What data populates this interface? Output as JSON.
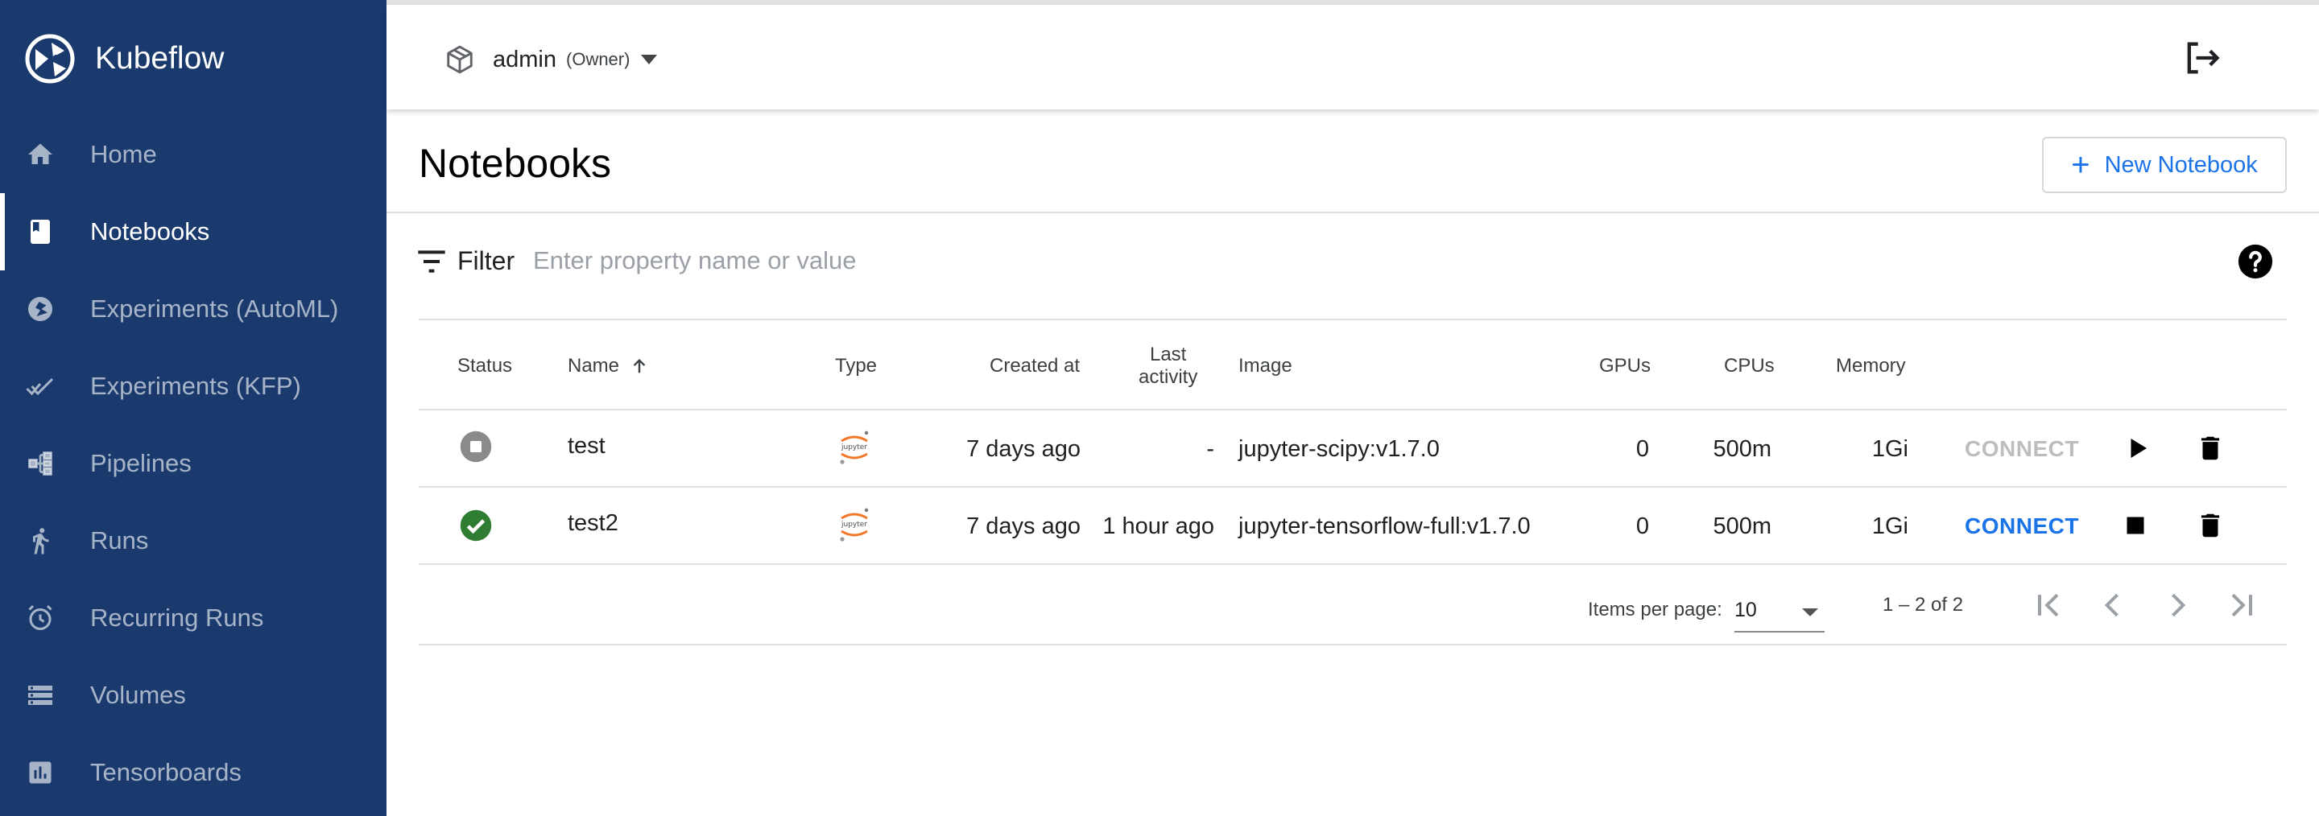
{
  "app": {
    "name": "Kubeflow"
  },
  "sidebar": {
    "items": [
      {
        "label": "Home",
        "icon": "home-icon",
        "active": false
      },
      {
        "label": "Notebooks",
        "icon": "notebook-icon",
        "active": true
      },
      {
        "label": "Experiments (AutoML)",
        "icon": "experiments-automl-icon",
        "active": false
      },
      {
        "label": "Experiments (KFP)",
        "icon": "experiments-kfp-icon",
        "active": false
      },
      {
        "label": "Pipelines",
        "icon": "pipelines-icon",
        "active": false
      },
      {
        "label": "Runs",
        "icon": "runs-icon",
        "active": false
      },
      {
        "label": "Recurring Runs",
        "icon": "alarm-icon",
        "active": false
      },
      {
        "label": "Volumes",
        "icon": "volumes-icon",
        "active": false
      },
      {
        "label": "Tensorboards",
        "icon": "tensorboards-icon",
        "active": false
      }
    ]
  },
  "header": {
    "namespace": "admin",
    "role": "(Owner)",
    "namespace_icon": "package-icon",
    "logout_icon": "logout-icon"
  },
  "page": {
    "title": "Notebooks",
    "new_button": {
      "label": "New Notebook",
      "icon": "plus-icon"
    }
  },
  "filter": {
    "label": "Filter",
    "placeholder": "Enter property name or value",
    "value": ""
  },
  "table": {
    "columns": {
      "status": "Status",
      "name": "Name",
      "type": "Type",
      "created": "Created at",
      "last_activity_1": "Last",
      "last_activity_2": "activity",
      "image": "Image",
      "gpus": "GPUs",
      "cpus": "CPUs",
      "memory": "Memory"
    },
    "sort": {
      "column": "Name",
      "direction": "ascending"
    },
    "rows": [
      {
        "status": "stopped",
        "name": "test",
        "type": "jupyter",
        "created": "7 days ago",
        "last_activity": "-",
        "image": "jupyter-scipy:v1.7.0",
        "gpus": "0",
        "cpus": "500m",
        "memory": "1Gi",
        "connect": "CONNECT",
        "connect_enabled": false,
        "action": "start"
      },
      {
        "status": "running",
        "name": "test2",
        "type": "jupyter",
        "created": "7 days ago",
        "last_activity": "1 hour ago",
        "image": "jupyter-tensorflow-full:v1.7.0",
        "gpus": "0",
        "cpus": "500m",
        "memory": "1Gi",
        "connect": "CONNECT",
        "connect_enabled": true,
        "action": "stop"
      }
    ]
  },
  "paginator": {
    "items_per_page_label": "Items per page:",
    "page_size": "10",
    "range": "1 – 2 of 2"
  },
  "colors": {
    "sidebar": "#1a3a6e",
    "accent": "#1a73e8",
    "running": "#2e7d32",
    "stopped": "#8a8a8a"
  }
}
